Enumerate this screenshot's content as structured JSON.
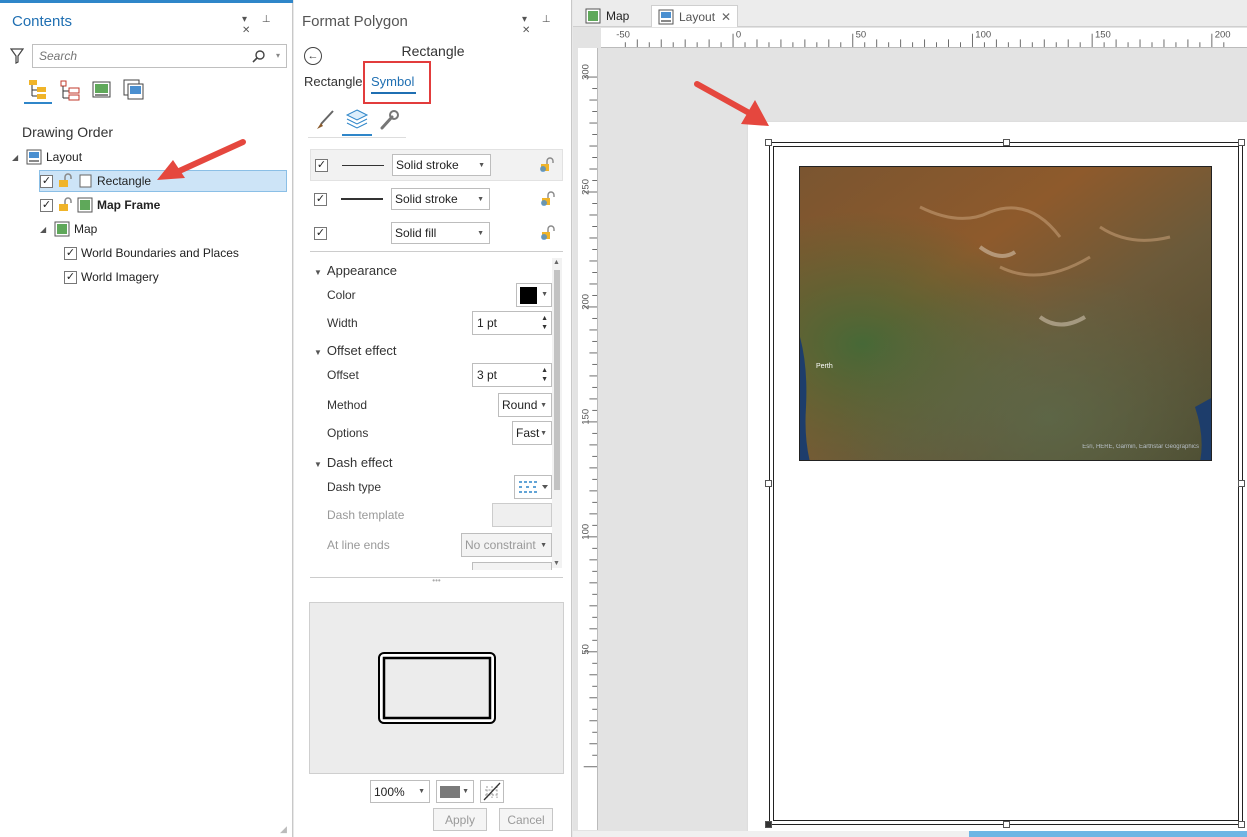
{
  "contents": {
    "title": "Contents",
    "search_placeholder": "Search",
    "section": "Drawing Order",
    "tree": [
      {
        "label": "Layout",
        "level": 0,
        "checkbox": false,
        "bold": false
      },
      {
        "label": "Rectangle",
        "level": 1,
        "checkbox": true,
        "bold": false,
        "selected": true
      },
      {
        "label": "Map Frame",
        "level": 1,
        "checkbox": true,
        "bold": true
      },
      {
        "label": "Map",
        "level": 1,
        "checkbox": false,
        "bold": false
      },
      {
        "label": "World Boundaries and Places",
        "level": 2,
        "checkbox": true,
        "bold": false
      },
      {
        "label": "World Imagery",
        "level": 2,
        "checkbox": true,
        "bold": false
      }
    ]
  },
  "format": {
    "title": "Format Polygon",
    "element": "Rectangle",
    "tabs": [
      "Rectangle",
      "Symbol"
    ],
    "active_tab": "Symbol",
    "layers": [
      {
        "checked": true,
        "type": "Solid stroke"
      },
      {
        "checked": true,
        "type": "Solid stroke"
      },
      {
        "checked": true,
        "type": "Solid fill"
      }
    ],
    "appearance": {
      "header": "Appearance",
      "color_label": "Color",
      "color": "#000000",
      "width_label": "Width",
      "width": "1 pt"
    },
    "offset": {
      "header": "Offset effect",
      "offset_label": "Offset",
      "offset": "3 pt",
      "method_label": "Method",
      "method": "Round",
      "options_label": "Options",
      "options": "Fast"
    },
    "dash": {
      "header": "Dash effect",
      "type_label": "Dash type",
      "template_label": "Dash template",
      "ends_label": "At line ends",
      "ends": "No constraint"
    },
    "zoom": "100%",
    "apply": "Apply",
    "cancel": "Cancel"
  },
  "layout_view": {
    "tabs": [
      {
        "label": "Map",
        "active": false
      },
      {
        "label": "Layout",
        "active": true
      }
    ],
    "hruler_labels": [
      "-50",
      "0",
      "50",
      "100",
      "150",
      "200"
    ],
    "vruler_labels": [
      "300",
      "250",
      "200",
      "150",
      "100",
      "50"
    ],
    "map_place": "Perth",
    "map_attribution": "Esri, HERE, Garmin, Earthstar Geographics"
  },
  "colors": {
    "accent": "#2f86c9",
    "highlight": "#e23c3c",
    "selection": "#cde4f7"
  }
}
